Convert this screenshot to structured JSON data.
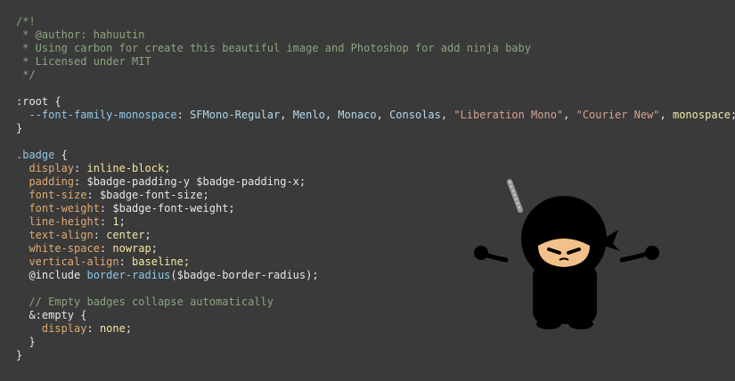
{
  "code": {
    "lines": [
      [
        {
          "t": "/*!",
          "c": "comment"
        }
      ],
      [
        {
          "t": " * @author: hahuutin",
          "c": "comment"
        }
      ],
      [
        {
          "t": " * Using carbon for create this beautiful image and Photoshop for add ninja baby",
          "c": "comment"
        }
      ],
      [
        {
          "t": " * Licensed under MIT",
          "c": "comment"
        }
      ],
      [
        {
          "t": " */",
          "c": "comment"
        }
      ],
      [],
      [
        {
          "t": ":root",
          "c": "selector"
        },
        {
          "t": " {",
          "c": "punct"
        }
      ],
      [
        {
          "t": "  --font-family-monospace",
          "c": "var"
        },
        {
          "t": ": ",
          "c": "punct"
        },
        {
          "t": "SFMono-Regular",
          "c": "value"
        },
        {
          "t": ", ",
          "c": "punct"
        },
        {
          "t": "Menlo",
          "c": "value"
        },
        {
          "t": ", ",
          "c": "punct"
        },
        {
          "t": "Monaco",
          "c": "value"
        },
        {
          "t": ", ",
          "c": "punct"
        },
        {
          "t": "Consolas",
          "c": "value"
        },
        {
          "t": ", ",
          "c": "punct"
        },
        {
          "t": "\"Liberation Mono\"",
          "c": "string"
        },
        {
          "t": ", ",
          "c": "punct"
        },
        {
          "t": "\"Courier New\"",
          "c": "string"
        },
        {
          "t": ", ",
          "c": "punct"
        },
        {
          "t": "monospace",
          "c": "ident"
        },
        {
          "t": ";",
          "c": "punct"
        }
      ],
      [
        {
          "t": "}",
          "c": "punct"
        }
      ],
      [],
      [
        {
          "t": ".badge",
          "c": "class"
        },
        {
          "t": " {",
          "c": "punct"
        }
      ],
      [
        {
          "t": "  display",
          "c": "prop"
        },
        {
          "t": ": ",
          "c": "punct"
        },
        {
          "t": "inline-block",
          "c": "ident"
        },
        {
          "t": ";",
          "c": "punct"
        }
      ],
      [
        {
          "t": "  padding",
          "c": "prop"
        },
        {
          "t": ": ",
          "c": "punct"
        },
        {
          "t": "$badge-padding-y $badge-padding-x",
          "c": "sass"
        },
        {
          "t": ";",
          "c": "punct"
        }
      ],
      [
        {
          "t": "  font-size",
          "c": "prop"
        },
        {
          "t": ": ",
          "c": "punct"
        },
        {
          "t": "$badge-font-size",
          "c": "sass"
        },
        {
          "t": ";",
          "c": "punct"
        }
      ],
      [
        {
          "t": "  font-weight",
          "c": "prop"
        },
        {
          "t": ": ",
          "c": "punct"
        },
        {
          "t": "$badge-font-weight",
          "c": "sass"
        },
        {
          "t": ";",
          "c": "punct"
        }
      ],
      [
        {
          "t": "  line-height",
          "c": "prop"
        },
        {
          "t": ": ",
          "c": "punct"
        },
        {
          "t": "1",
          "c": "ident"
        },
        {
          "t": ";",
          "c": "punct"
        }
      ],
      [
        {
          "t": "  text-align",
          "c": "prop"
        },
        {
          "t": ": ",
          "c": "punct"
        },
        {
          "t": "center",
          "c": "ident"
        },
        {
          "t": ";",
          "c": "punct"
        }
      ],
      [
        {
          "t": "  white-space",
          "c": "prop"
        },
        {
          "t": ": ",
          "c": "punct"
        },
        {
          "t": "nowrap",
          "c": "ident"
        },
        {
          "t": ";",
          "c": "punct"
        }
      ],
      [
        {
          "t": "  vertical-align",
          "c": "prop"
        },
        {
          "t": ": ",
          "c": "punct"
        },
        {
          "t": "baseline",
          "c": "ident"
        },
        {
          "t": ";",
          "c": "punct"
        }
      ],
      [
        {
          "t": "  @include ",
          "c": "keyword"
        },
        {
          "t": "border-radius",
          "c": "fn"
        },
        {
          "t": "($badge-border-radius);",
          "c": "plain"
        }
      ],
      [],
      [
        {
          "t": "  // Empty badges collapse automatically",
          "c": "comment"
        }
      ],
      [
        {
          "t": "  &:empty",
          "c": "selector"
        },
        {
          "t": " {",
          "c": "punct"
        }
      ],
      [
        {
          "t": "    display",
          "c": "prop"
        },
        {
          "t": ": ",
          "c": "punct"
        },
        {
          "t": "none",
          "c": "ident"
        },
        {
          "t": ";",
          "c": "punct"
        }
      ],
      [
        {
          "t": "  }",
          "c": "punct"
        }
      ],
      [
        {
          "t": "}",
          "c": "punct"
        }
      ]
    ]
  },
  "colors": {
    "background": "#3a3a3a",
    "comment": "#8aa57e",
    "property": "#e0a96f",
    "variable": "#8fc7e6",
    "string": "#d9a090",
    "ident": "#f2e6a6"
  },
  "illustration": {
    "icon": "ninja-baby-icon"
  }
}
